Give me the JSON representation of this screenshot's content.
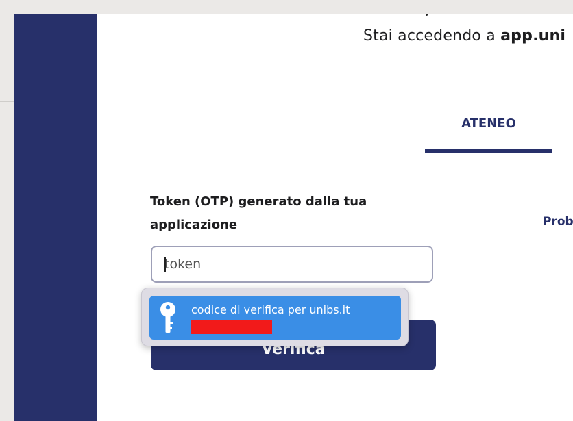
{
  "header": {
    "prefix": "Stai accedendo a ",
    "domain": "app.uni"
  },
  "tabs": [
    {
      "label": "ATENEO",
      "active": true
    }
  ],
  "form": {
    "field_label": "Token (OTP) generato dalla tua applicazione",
    "input_placeholder": "token",
    "input_value": "",
    "submit_label": "Verifica"
  },
  "side_link": "Prob",
  "autofill": {
    "item_title": "codice di verifica per unibs.it",
    "icon": "key-icon"
  },
  "colors": {
    "brand": "#27306a",
    "autofill_highlight": "#3a8ee6",
    "redaction": "#f21a1a"
  }
}
